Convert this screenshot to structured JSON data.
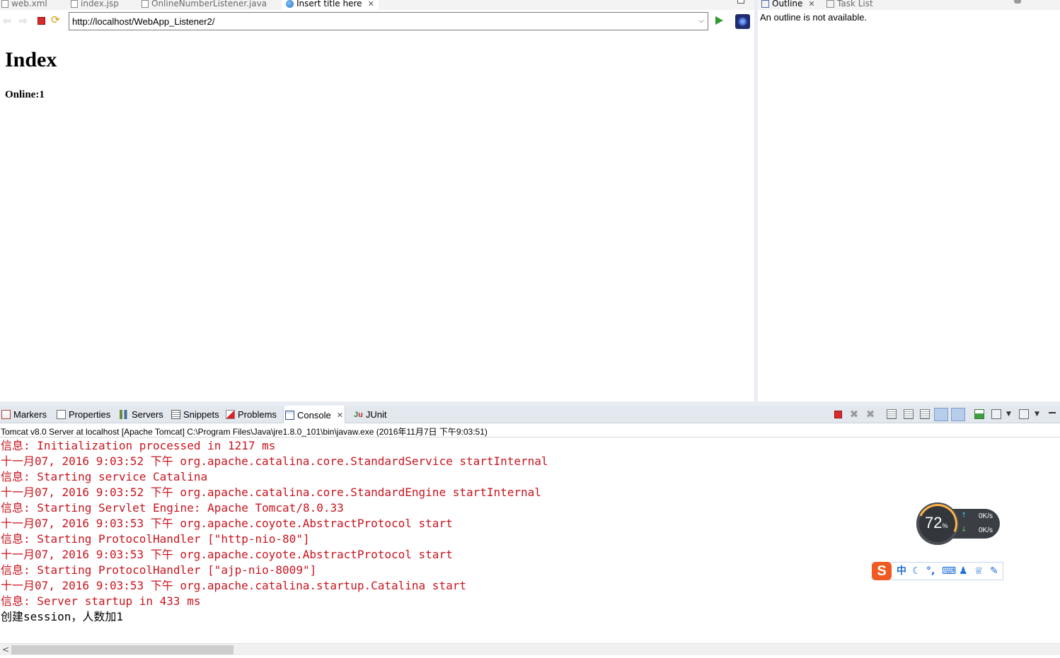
{
  "editor_tabs": [
    {
      "label": "web.xml"
    },
    {
      "label": "index.jsp"
    },
    {
      "label": "OnlineNumberListener.java"
    },
    {
      "label": "Insert title here",
      "active": true
    }
  ],
  "browser": {
    "url": "http://localhost/WebApp_Listener2/"
  },
  "page": {
    "heading": "Index",
    "online_text": "Online:1"
  },
  "outline": {
    "tabs": [
      "Outline",
      "Task List"
    ],
    "message": "An outline is not available."
  },
  "view_tabs": [
    {
      "label": "Markers",
      "icon": "markers-icon"
    },
    {
      "label": "Properties",
      "icon": "properties-icon"
    },
    {
      "label": "Servers",
      "icon": "servers-icon"
    },
    {
      "label": "Snippets",
      "icon": "snippets-icon"
    },
    {
      "label": "Problems",
      "icon": "problems-icon"
    },
    {
      "label": "Console",
      "icon": "console-icon",
      "active": true
    },
    {
      "label": "JUnit",
      "icon": "junit-icon"
    }
  ],
  "console": {
    "title": "Tomcat v8.0 Server at localhost [Apache Tomcat] C:\\Program Files\\Java\\jre1.8.0_101\\bin\\javaw.exe (2016年11月7日 下午9:03:51)",
    "lines": [
      {
        "text": "信息: Initialization processed in 1217 ms",
        "stream": "err"
      },
      {
        "text": "十一月07, 2016 9:03:52 下午 org.apache.catalina.core.StandardService startInternal",
        "stream": "err"
      },
      {
        "text": "信息: Starting service Catalina",
        "stream": "err"
      },
      {
        "text": "十一月07, 2016 9:03:52 下午 org.apache.catalina.core.StandardEngine startInternal",
        "stream": "err"
      },
      {
        "text": "信息: Starting Servlet Engine: Apache Tomcat/8.0.33",
        "stream": "err"
      },
      {
        "text": "十一月07, 2016 9:03:53 下午 org.apache.coyote.AbstractProtocol start",
        "stream": "err"
      },
      {
        "text": "信息: Starting ProtocolHandler [\"http-nio-80\"]",
        "stream": "err"
      },
      {
        "text": "十一月07, 2016 9:03:53 下午 org.apache.coyote.AbstractProtocol start",
        "stream": "err"
      },
      {
        "text": "信息: Starting ProtocolHandler [\"ajp-nio-8009\"]",
        "stream": "err"
      },
      {
        "text": "十一月07, 2016 9:03:53 下午 org.apache.catalina.startup.Catalina start",
        "stream": "err"
      },
      {
        "text": "信息: Server startup in 433 ms",
        "stream": "err"
      },
      {
        "text": "创建session，人数加1",
        "stream": "out"
      }
    ]
  },
  "net_monitor": {
    "percent": "72",
    "percent_unit": "%",
    "upload": "0K/s",
    "download": "0K/s"
  },
  "ime_toolbar": {
    "logo": "S",
    "mode": "中"
  },
  "colors": {
    "console_error": "#c8141e",
    "active_tab_bg": "#ffffff",
    "panel_bg": "#e3e8ef"
  }
}
